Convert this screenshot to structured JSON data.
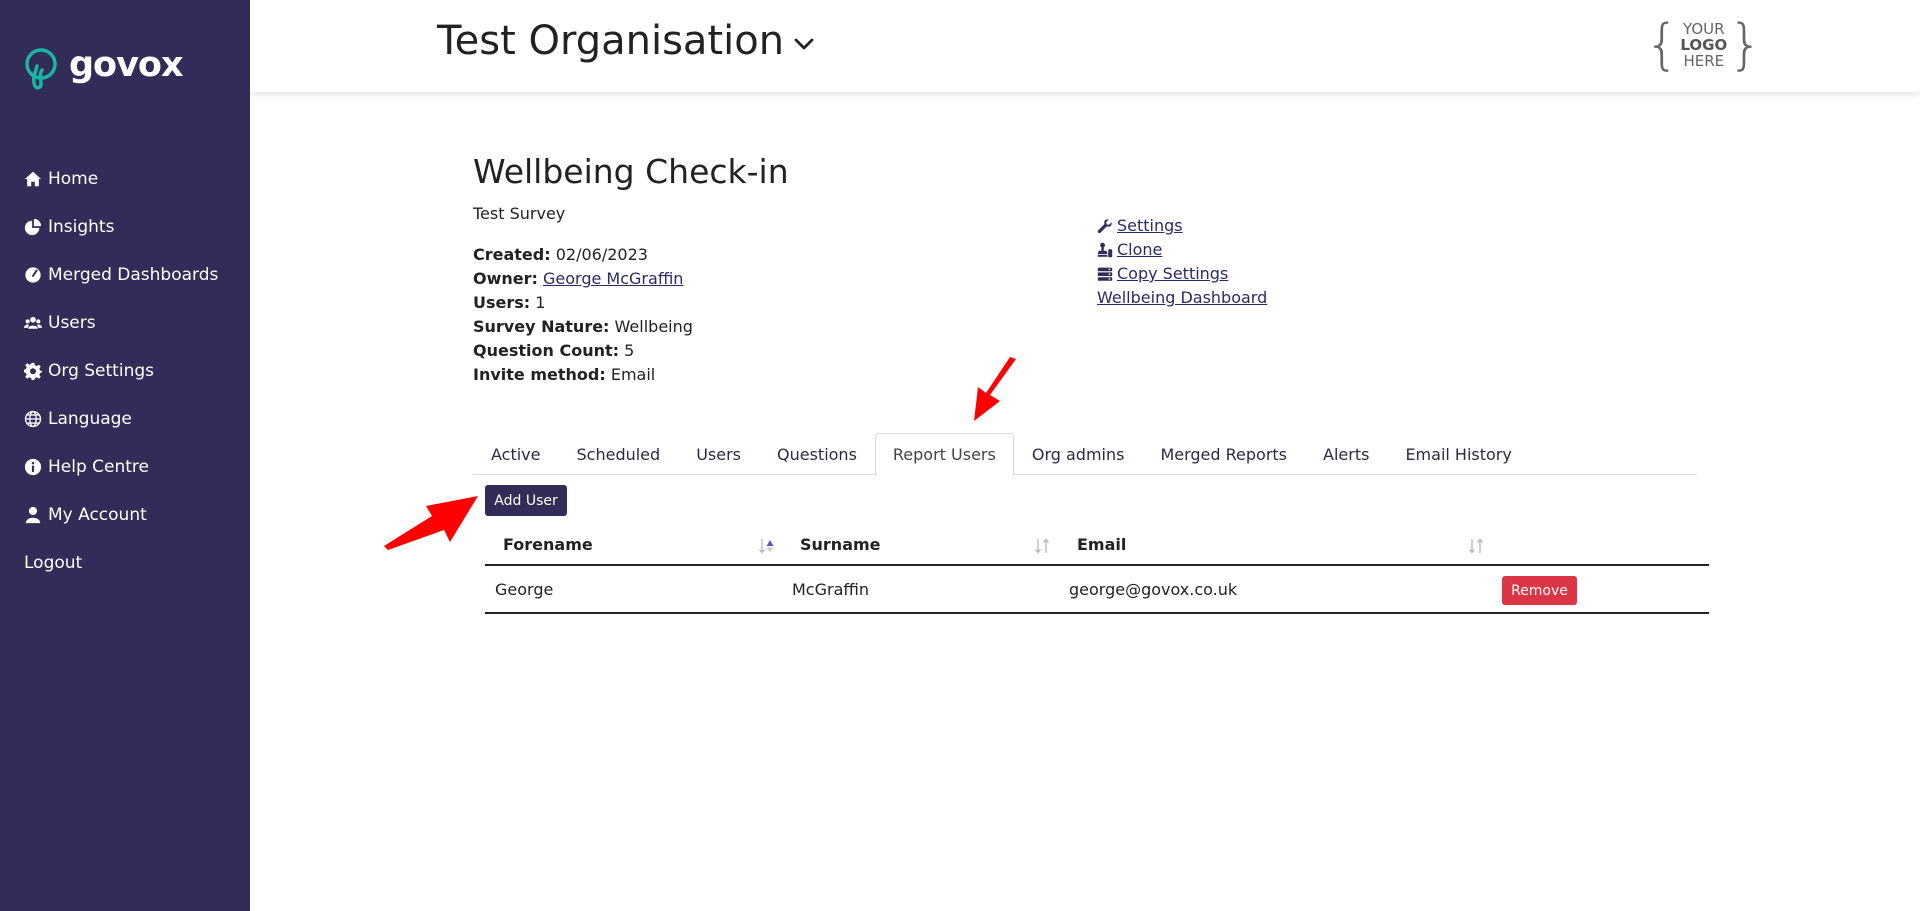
{
  "sidebar": {
    "brand": "govox",
    "items": [
      {
        "label": "Home",
        "icon": "home-icon"
      },
      {
        "label": "Insights",
        "icon": "pie-chart-icon"
      },
      {
        "label": "Merged Dashboards",
        "icon": "gauge-icon"
      },
      {
        "label": "Users",
        "icon": "users-icon"
      },
      {
        "label": "Org Settings",
        "icon": "gear-icon"
      },
      {
        "label": "Language",
        "icon": "globe-icon"
      },
      {
        "label": "Help Centre",
        "icon": "info-icon"
      },
      {
        "label": "My Account",
        "icon": "user-icon"
      },
      {
        "label": "Logout",
        "icon": ""
      }
    ]
  },
  "header": {
    "org_name": "Test Organisation",
    "logo_placeholder": {
      "line1": "YOUR",
      "line2": "LOGO",
      "line3": "HERE"
    }
  },
  "survey": {
    "title": "Wellbeing Check-in",
    "subtitle": "Test Survey",
    "meta": {
      "created_label": "Created:",
      "created": "02/06/2023",
      "owner_label": "Owner:",
      "owner": "George McGraffin",
      "users_label": "Users:",
      "users": "1",
      "nature_label": "Survey Nature:",
      "nature": "Wellbeing",
      "qcount_label": "Question Count:",
      "qcount": "5",
      "invite_label": "Invite method:",
      "invite": "Email"
    },
    "actions": {
      "settings": " Settings",
      "clone": " Clone",
      "copy_settings": " Copy Settings",
      "dashboard": "Wellbeing Dashboard"
    }
  },
  "tabs": [
    {
      "label": "Active"
    },
    {
      "label": "Scheduled"
    },
    {
      "label": "Users"
    },
    {
      "label": "Questions"
    },
    {
      "label": "Report Users",
      "active": true
    },
    {
      "label": "Org admins"
    },
    {
      "label": "Merged Reports"
    },
    {
      "label": "Alerts"
    },
    {
      "label": "Email History"
    }
  ],
  "report_users": {
    "add_label": "Add User",
    "columns": {
      "forename": "Forename",
      "surname": "Surname",
      "email": "Email"
    },
    "rows": [
      {
        "forename": "George",
        "surname": "McGraffin",
        "email": "george@govox.co.uk",
        "remove_label": "Remove"
      }
    ]
  },
  "colors": {
    "sidebar": "#322d58",
    "accent": "#322d58",
    "danger": "#dc3545",
    "annotation": "#ff0000"
  }
}
